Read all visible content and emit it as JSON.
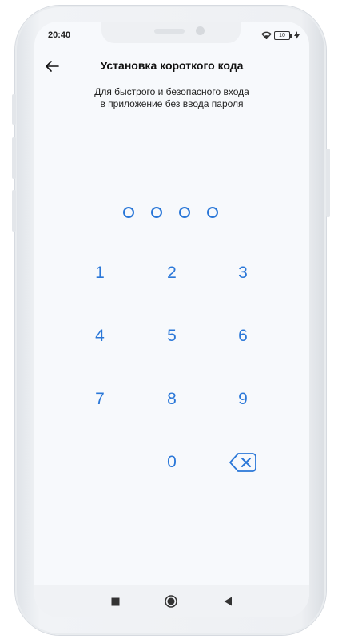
{
  "status_bar": {
    "time": "20:40",
    "battery_level": "10",
    "icons": [
      "wifi-icon",
      "battery-icon",
      "charging-icon"
    ]
  },
  "header": {
    "back_icon": "arrow-left-icon",
    "title": "Установка короткого кода"
  },
  "subtitle": {
    "line1": "Для быстрого и безопасного входа",
    "line2": "в приложение без ввода пароля"
  },
  "pin": {
    "length": 4,
    "entered": 0
  },
  "keypad": {
    "k1": "1",
    "k2": "2",
    "k3": "3",
    "k4": "4",
    "k5": "5",
    "k6": "6",
    "k7": "7",
    "k8": "8",
    "k9": "9",
    "k0": "0",
    "backspace_icon": "backspace-icon"
  },
  "nav_bar": {
    "icons": [
      "recent-apps-icon",
      "home-icon",
      "back-icon"
    ]
  },
  "colors": {
    "accent": "#2a77d8",
    "screen_bg": "#f7f9fc",
    "text": "#111111"
  }
}
